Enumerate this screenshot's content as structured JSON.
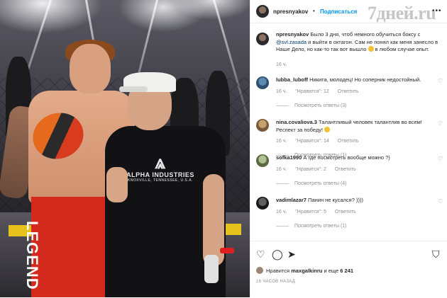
{
  "watermark": "7дней.ru",
  "post": {
    "username": "npresnyakov",
    "follow_label": "Подписаться",
    "more_label": "•••",
    "caption_user": "npresnyakov",
    "caption_part1": "Было 3 дня, чтоб немного обучиться боксу с",
    "caption_mention": "@svl.zasada",
    "caption_part2": "и выйти в октагон. Сам не понял как меня занесло в Наше Дело, но как-то так вот вышло",
    "caption_part3": "в любом случае опыт.",
    "caption_time": "16 ч."
  },
  "comments": [
    {
      "user": "lubba_luboff",
      "text": "Никита, молодец! Но соперник недостойный.",
      "time": "16 ч.",
      "likes": "\"Нравится\": 12",
      "reply": "Ответить",
      "replies": "Посмотреть ответы (3)"
    },
    {
      "user": "nina.covaliova.3",
      "text": "Талантливый человек талантлив во всем! Респект за победу!",
      "time": "16 ч.",
      "likes": "\"Нравится\": 14",
      "reply": "Ответить",
      "replies": "Посмотреть ответы (1)"
    },
    {
      "user": "sofka1990",
      "text": "А где посмотреть вообще можно ?)",
      "time": "16 ч.",
      "likes": "\"Нравится\": 2",
      "reply": "Ответить",
      "replies": "Посмотреть ответы (4)"
    },
    {
      "user": "vadimlazar7",
      "text": "Панин не кусался? ))))",
      "time": "16 ч.",
      "likes": "\"Нравится\": 5",
      "reply": "Ответить",
      "replies": "Посмотреть ответы (1)"
    }
  ],
  "footer": {
    "likes_prefix": "Нравится",
    "likes_user": "maxgalkinru",
    "likes_middle": "и еще",
    "likes_count": "6 241",
    "time_ago": "16 ЧАСОВ НАЗАД"
  },
  "photo": {
    "shirt_brand": "ALPHA INDUSTRIES",
    "shirt_sub": "KNOXVILLE, TENNESSEE, U.S.A.",
    "shorts_text": "LEGEND"
  },
  "icons": {
    "like": "heart-icon",
    "comment": "comment-icon",
    "share": "share-icon",
    "save": "bookmark-icon"
  }
}
